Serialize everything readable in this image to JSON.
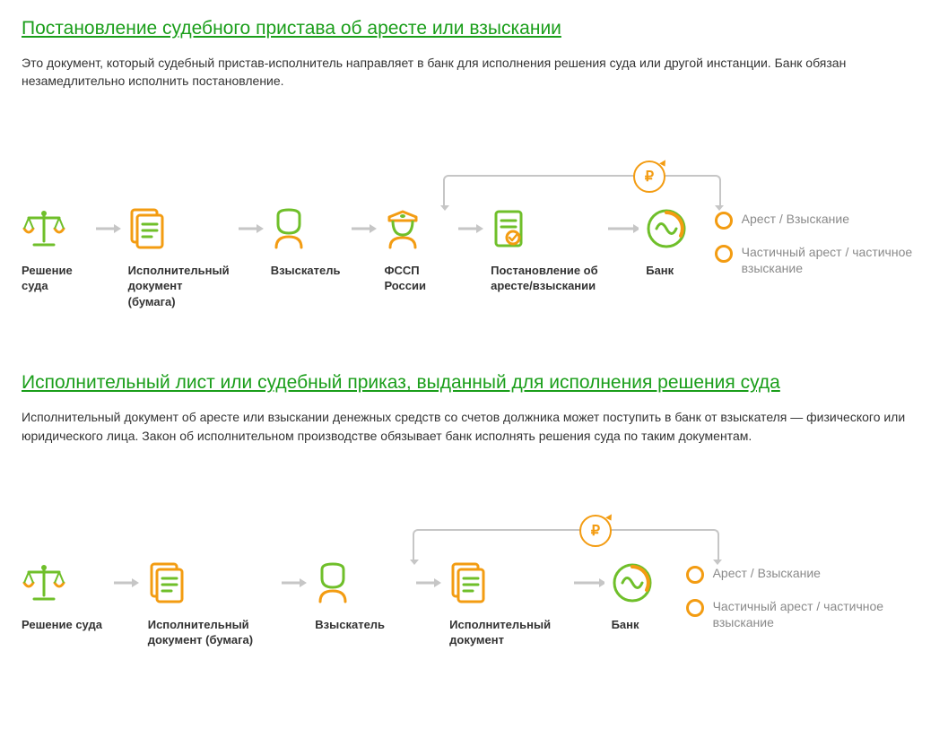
{
  "section1": {
    "title": "Постановление судебного пристава об аресте или взыскании",
    "desc": "Это документ, который судебный пристав-исполнитель направляет в банк для исполнения решения суда или другой инстанции. Банк обязан незамедлительно исполнить постановление.",
    "steps": {
      "s1": "Решение суда",
      "s2": "Исполнительный документ (бумага)",
      "s3": "Взыскатель",
      "s4": "ФССП России",
      "s5": "Постановление об аресте/взыскании",
      "s6": "Банк"
    },
    "outcomes": {
      "o1": "Арест / Взыскание",
      "o2": "Частичный арест / частичное взыскание"
    },
    "ruble": "₽"
  },
  "section2": {
    "title": "Исполнительный лист или судебный приказ, выданный для исполнения решения суда",
    "desc": "Исполнительный документ об аресте или взыскании денежных средств со счетов должника может поступить в банк от взыскателя — физического или юридического лица. Закон об исполнительном производстве обязывает банк исполнять решения суда по таким документам.",
    "steps": {
      "s1": "Решение суда",
      "s2": "Исполнительный документ (бумага)",
      "s3": "Взыскатель",
      "s4": "Исполнительный документ",
      "s5": "Банк"
    },
    "outcomes": {
      "o1": "Арест / Взыскание",
      "o2": "Частичный арест / частичное взыскание"
    },
    "ruble": "₽"
  }
}
